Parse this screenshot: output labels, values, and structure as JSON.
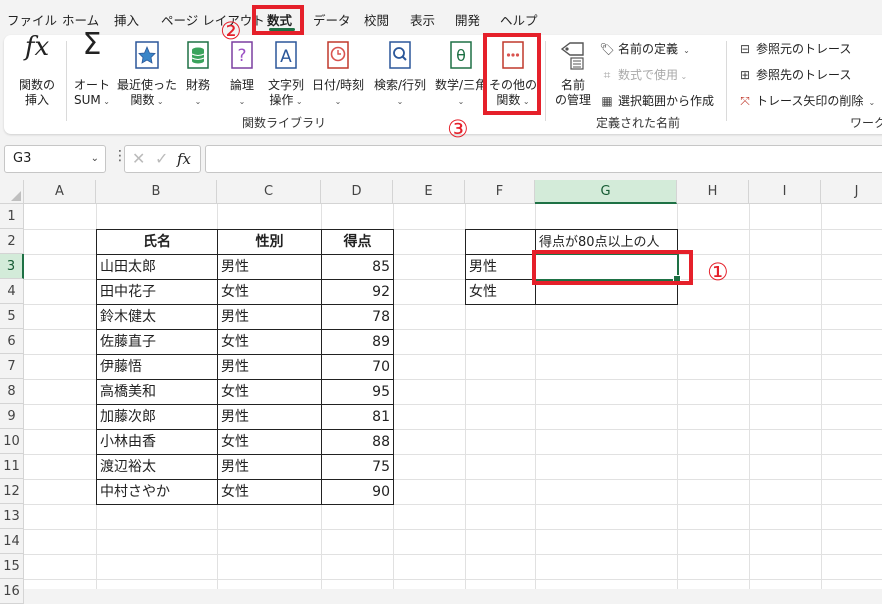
{
  "tabs": [
    "ファイル",
    "ホーム",
    "挿入",
    "ページ レイアウト",
    "数式",
    "データ",
    "校閲",
    "表示",
    "開発",
    "ヘルプ"
  ],
  "active_tab": "数式",
  "markers": {
    "one": "①",
    "two": "②",
    "three": "③"
  },
  "ribbon": {
    "insert_function": {
      "icon": "fx-icon",
      "line1": "関数の",
      "line2": "挿入"
    },
    "autosum": {
      "icon": "sigma-icon",
      "line1": "オート",
      "line2": "SUM"
    },
    "recent": {
      "icon": "star-icon",
      "line1": "最近使った",
      "line2": "関数"
    },
    "financial": {
      "icon": "database-icon",
      "line1": "財務"
    },
    "logical": {
      "icon": "question-icon",
      "line1": "論理"
    },
    "text": {
      "icon": "letter-a-icon",
      "line1": "文字列",
      "line2": "操作"
    },
    "datetime": {
      "icon": "clock-icon",
      "line1": "日付/時刻"
    },
    "lookup": {
      "icon": "magnifier-icon",
      "line1": "検索/行列"
    },
    "math": {
      "icon": "theta-icon",
      "line1": "数学/三角"
    },
    "more": {
      "icon": "ellipsis-icon",
      "line1": "その他の",
      "line2": "関数"
    },
    "group_function_library": "関数ライブラリ",
    "name_manager": {
      "icon": "tag-icon",
      "line1": "名前",
      "line2": "の管理"
    },
    "define_name": "名前の定義",
    "use_in_formula": "数式で使用",
    "create_from_selection": "選択範囲から作成",
    "group_defined_names": "定義された名前",
    "trace_precedents": "参照元のトレース",
    "trace_dependents": "参照先のトレース",
    "remove_arrows": "トレース矢印の削除",
    "group_formula_auditing": "ワークシ"
  },
  "formula_bar": {
    "name_box": "G3",
    "fx": "fx",
    "formula": ""
  },
  "columns": [
    "A",
    "B",
    "C",
    "D",
    "E",
    "F",
    "G",
    "H",
    "I",
    "J"
  ],
  "rows": [
    "1",
    "2",
    "3",
    "4",
    "5",
    "6",
    "7",
    "8",
    "9",
    "10",
    "11",
    "12",
    "13",
    "14",
    "15",
    "16"
  ],
  "selected_column": "G",
  "selected_row": "3",
  "table_headers": {
    "name": "氏名",
    "gender": "性別",
    "score": "得点"
  },
  "table_rows": [
    {
      "name": "山田太郎",
      "gender": "男性",
      "score": "85"
    },
    {
      "name": "田中花子",
      "gender": "女性",
      "score": "92"
    },
    {
      "name": "鈴木健太",
      "gender": "男性",
      "score": "78"
    },
    {
      "name": "佐藤直子",
      "gender": "女性",
      "score": "89"
    },
    {
      "name": "伊藤悟",
      "gender": "男性",
      "score": "70"
    },
    {
      "name": "高橋美和",
      "gender": "女性",
      "score": "95"
    },
    {
      "name": "加藤次郎",
      "gender": "男性",
      "score": "81"
    },
    {
      "name": "小林由香",
      "gender": "女性",
      "score": "88"
    },
    {
      "name": "渡辺裕太",
      "gender": "男性",
      "score": "75"
    },
    {
      "name": "中村さやか",
      "gender": "女性",
      "score": "90"
    }
  ],
  "summary": {
    "header": "得点が80点以上の人",
    "rows": [
      {
        "label": "男性",
        "value": ""
      },
      {
        "label": "女性",
        "value": ""
      }
    ]
  },
  "colors": {
    "accent_green": "#1e7145",
    "highlight_red": "#e5202a"
  }
}
